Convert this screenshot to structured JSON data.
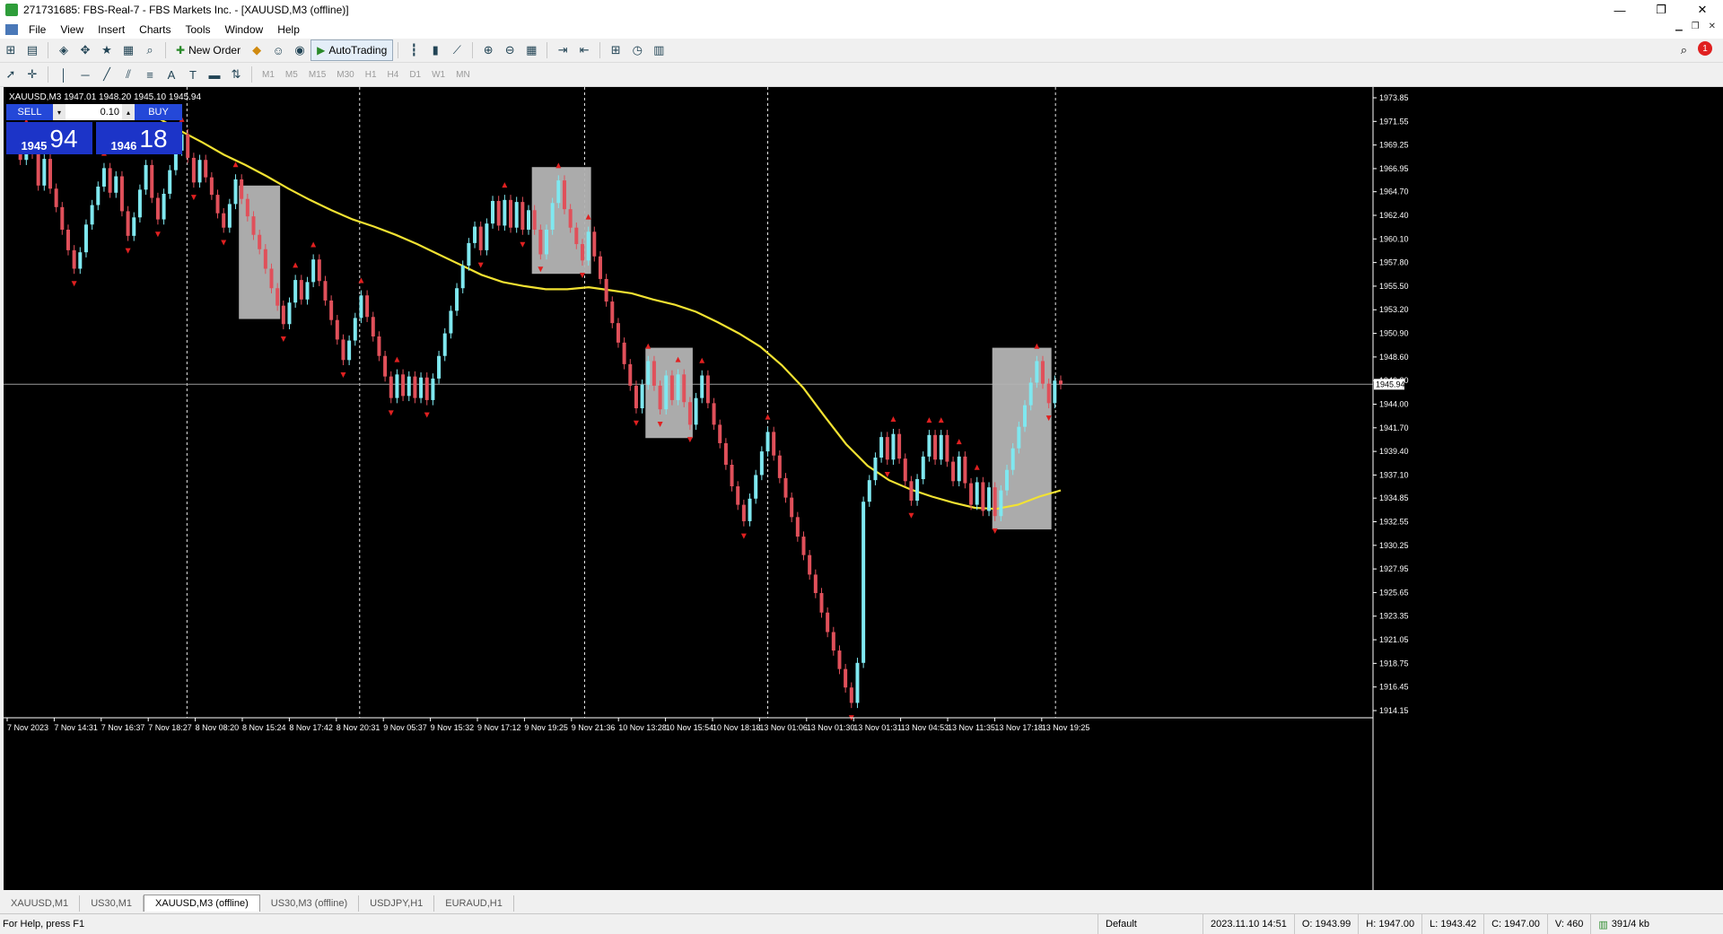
{
  "window": {
    "title": "271731685: FBS-Real-7 - FBS Markets Inc. - [XAUUSD,M3 (offline)]",
    "controls": [
      "—",
      "❐",
      "✕"
    ]
  },
  "menu": [
    "File",
    "View",
    "Insert",
    "Charts",
    "Tools",
    "Window",
    "Help"
  ],
  "toolbar": {
    "new_order": "New Order",
    "autotrading": "AutoTrading",
    "timeframes": [
      "M1",
      "M5",
      "M15",
      "M30",
      "H1",
      "H4",
      "D1",
      "W1",
      "MN"
    ],
    "alert_count": "1"
  },
  "chart": {
    "header": "XAUUSD,M3  1947.01 1948.20 1945.10 1945.94",
    "current_price": "1945.94",
    "colors": {
      "bull": "#7fe8f0",
      "bear": "#e0505a",
      "ma": "#f2e232",
      "grid": "#ffffff",
      "box": "#b4b4b4",
      "arrow": "#e02020"
    }
  },
  "one_click": {
    "sell_label": "SELL",
    "buy_label": "BUY",
    "lot": "0.10",
    "sell_big": "1945",
    "sell_small": "94",
    "buy_big": "1946",
    "buy_small": "18"
  },
  "chart_data": {
    "type": "candlestick",
    "title": "XAUUSD,M3",
    "y_ticks": [
      "1973.85",
      "1971.55",
      "1969.25",
      "1966.95",
      "1964.70",
      "1962.40",
      "1960.10",
      "1957.80",
      "1955.50",
      "1953.20",
      "1950.90",
      "1948.60",
      "1946.30",
      "1944.00",
      "1941.70",
      "1939.40",
      "1937.10",
      "1934.85",
      "1932.55",
      "1930.25",
      "1927.95",
      "1925.65",
      "1923.35",
      "1921.05",
      "1918.75",
      "1916.45",
      "1914.15"
    ],
    "ylim": [
      1914.15,
      1973.85
    ],
    "x_ticks": [
      "7 Nov 2023",
      "7 Nov 14:31",
      "7 Nov 16:37",
      "7 Nov 18:27",
      "8 Nov 08:20",
      "8 Nov 15:24",
      "8 Nov 17:42",
      "8 Nov 20:31",
      "9 Nov 05:37",
      "9 Nov 15:32",
      "9 Nov 17:12",
      "9 Nov 19:25",
      "9 Nov 21:36",
      "10 Nov 13:28",
      "10 Nov 15:54",
      "10 Nov 18:18",
      "13 Nov 01:06",
      "13 Nov 01:30",
      "13 Nov 01:31",
      "13 Nov 04:53",
      "13 Nov 11:35",
      "13 Nov 17:18",
      "13 Nov 19:25"
    ],
    "closes": [
      1969.5,
      1967.8,
      1970.1,
      1968.4,
      1965.3,
      1967.9,
      1965.0,
      1963.2,
      1961.0,
      1959.0,
      1957.2,
      1958.8,
      1961.5,
      1963.4,
      1965.2,
      1967.0,
      1964.6,
      1966.2,
      1962.8,
      1960.4,
      1962.2,
      1964.9,
      1967.3,
      1964.1,
      1962.0,
      1964.5,
      1966.8,
      1968.7,
      1970.3,
      1968.0,
      1965.6,
      1967.8,
      1966.1,
      1964.4,
      1962.6,
      1961.2,
      1963.5,
      1965.9,
      1964.0,
      1962.3,
      1960.5,
      1959.1,
      1957.2,
      1955.3,
      1953.6,
      1951.8,
      1953.9,
      1956.1,
      1954.2,
      1955.9,
      1958.1,
      1956.0,
      1954.1,
      1952.2,
      1950.3,
      1948.3,
      1950.2,
      1952.4,
      1954.6,
      1952.5,
      1950.6,
      1948.7,
      1946.7,
      1944.6,
      1946.9,
      1944.8,
      1946.7,
      1944.6,
      1946.6,
      1944.4,
      1946.5,
      1948.7,
      1950.9,
      1953.1,
      1955.3,
      1957.5,
      1959.7,
      1961.3,
      1959.0,
      1961.6,
      1963.8,
      1961.4,
      1963.9,
      1961.2,
      1963.7,
      1961.0,
      1962.9,
      1961.0,
      1958.6,
      1961.0,
      1963.6,
      1965.8,
      1963.0,
      1961.2,
      1959.6,
      1958.0,
      1960.8,
      1958.4,
      1956.2,
      1954.0,
      1951.9,
      1950.0,
      1947.9,
      1945.8,
      1943.6,
      1945.9,
      1948.2,
      1945.8,
      1943.5,
      1946.8,
      1944.4,
      1946.9,
      1944.2,
      1942.0,
      1944.6,
      1946.8,
      1944.1,
      1942.0,
      1940.2,
      1938.1,
      1936.0,
      1934.2,
      1932.6,
      1934.8,
      1937.1,
      1939.4,
      1941.3,
      1939.0,
      1936.8,
      1934.9,
      1933.0,
      1931.1,
      1929.3,
      1927.4,
      1925.6,
      1923.7,
      1921.8,
      1920.0,
      1918.2,
      1916.4,
      1914.9,
      1918.8,
      1934.5,
      1936.6,
      1938.8,
      1940.8,
      1938.6,
      1941.1,
      1938.7,
      1936.5,
      1934.6,
      1936.7,
      1938.9,
      1941.0,
      1938.6,
      1941.0,
      1938.4,
      1936.5,
      1938.9,
      1936.3,
      1934.2,
      1936.4,
      1933.6,
      1935.9,
      1933.1,
      1935.6,
      1937.6,
      1939.7,
      1941.8,
      1943.9,
      1946.1,
      1948.2,
      1946.0,
      1944.1,
      1946.3,
      1945.94
    ],
    "ma_series": [
      1972.5,
      1971.8,
      1970.6,
      1969.5,
      1968.3,
      1967.3,
      1966.2,
      1965.0,
      1963.9,
      1962.9,
      1962.0,
      1961.3,
      1960.5,
      1959.6,
      1958.6,
      1957.6,
      1956.6,
      1955.9,
      1955.5,
      1955.2,
      1955.2,
      1955.4,
      1955.1,
      1954.8,
      1954.2,
      1953.7,
      1953.0,
      1952.0,
      1950.9,
      1949.6,
      1947.8,
      1945.6,
      1942.8,
      1940.1,
      1938.0,
      1936.6,
      1935.7,
      1935.0,
      1934.4,
      1933.9,
      1933.8,
      1934.2,
      1935.0,
      1935.6
    ]
  },
  "tabs": [
    "XAUUSD,M1",
    "US30,M1",
    "XAUUSD,M3 (offline)",
    "US30,M3 (offline)",
    "USDJPY,H1",
    "EURAUD,H1"
  ],
  "active_tab": 2,
  "status": {
    "help": "For Help, press F1",
    "profile": "Default",
    "datetime": "2023.11.10 14:51",
    "open": "O: 1943.99",
    "high": "H: 1947.00",
    "low": "L: 1943.42",
    "close": "C: 1947.00",
    "volume": "V: 460",
    "traffic": "391/4 kb"
  }
}
